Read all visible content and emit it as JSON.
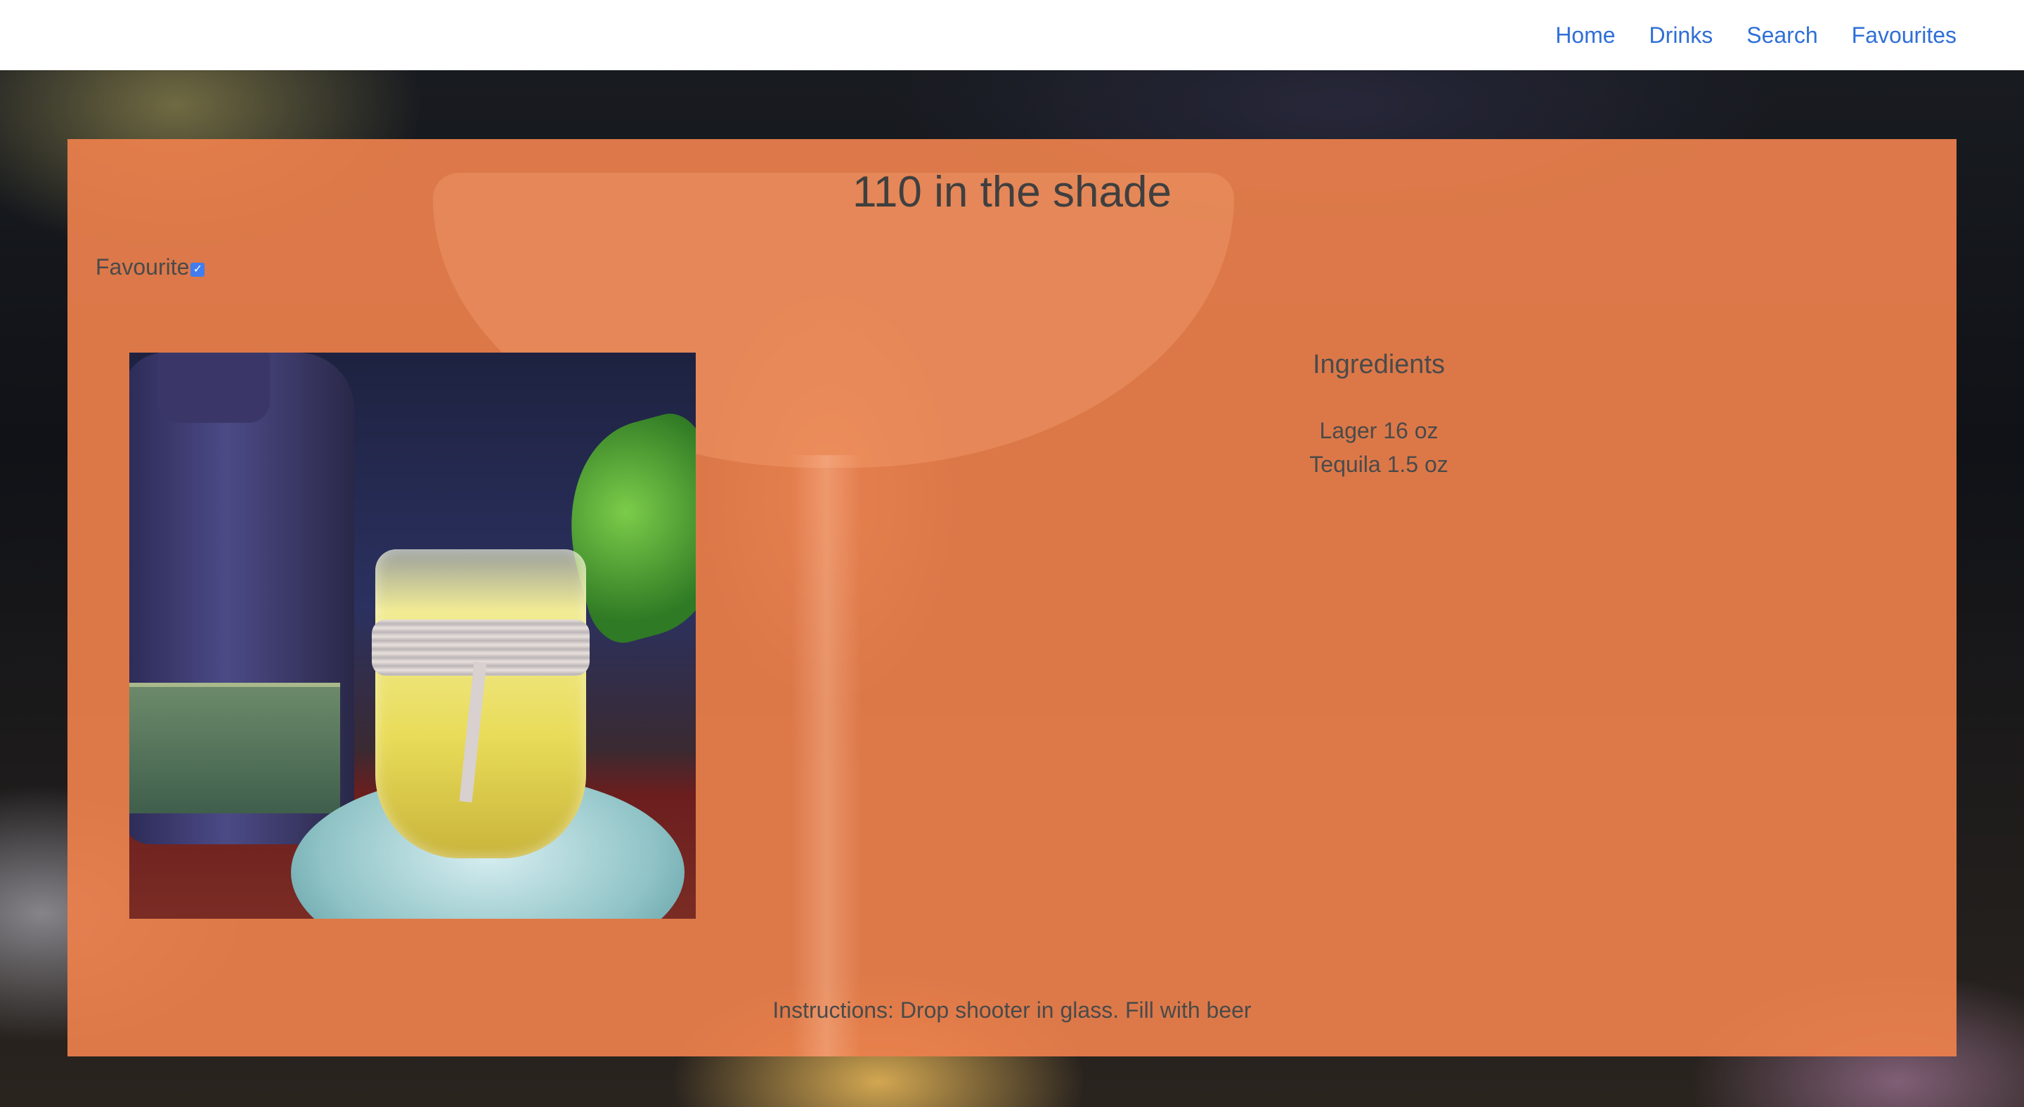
{
  "nav": {
    "links": [
      {
        "label": "Home"
      },
      {
        "label": "Drinks"
      },
      {
        "label": "Search"
      },
      {
        "label": "Favourites"
      }
    ],
    "link_color": "#2f6fd6"
  },
  "drink": {
    "title": "110 in the shade",
    "favourite_label": "Favourite",
    "favourite_checked": true,
    "photo_description_icon": "drink-photo",
    "ingredients_heading": "Ingredients",
    "ingredients": [
      "Lager 16 oz",
      "Tequila 1.5 oz"
    ],
    "instructions": "Instructions: Drop shooter in glass. Fill with beer"
  },
  "colors": {
    "card_background": "#ec804c",
    "text": "#4a4a4a",
    "checkbox": "#3f7df0"
  }
}
